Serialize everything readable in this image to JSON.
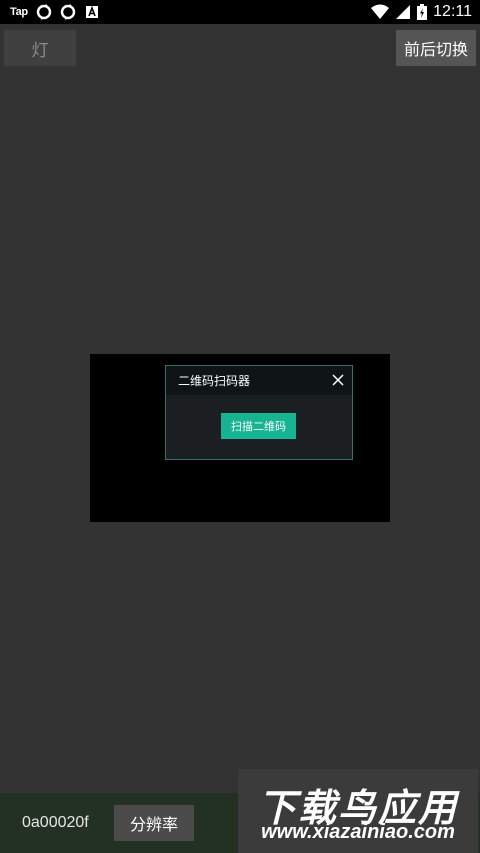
{
  "status_bar": {
    "left_text": "Tap",
    "left_icons": [
      "sync-icon",
      "sync-icon",
      "a-notification-icon"
    ],
    "right_icons": [
      "wifi-icon",
      "signal-icon",
      "battery-icon"
    ],
    "time": "12:11"
  },
  "top": {
    "light_label": "灯",
    "switch_label": "前后切换"
  },
  "dialog": {
    "title": "二维码扫码器",
    "scan_label": "扫描二维码",
    "close_icon": "close-icon"
  },
  "bottom": {
    "code": "0a00020f",
    "resolution_label": "分辨率"
  },
  "watermark": {
    "line1": "下载鸟应用",
    "line2": "www.xiazainiao.com"
  },
  "colors": {
    "background": "#333333",
    "accent": "#17b493",
    "bottom_bar": "#233123"
  }
}
